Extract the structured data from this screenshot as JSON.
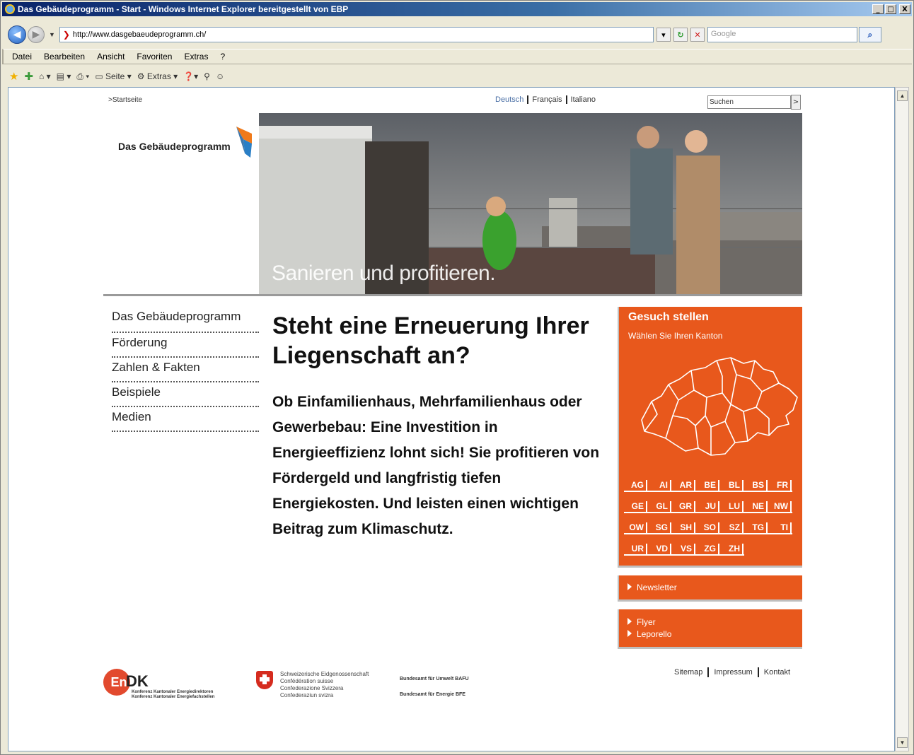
{
  "window": {
    "title": "Das Gebäudeprogramm - Start - Windows Internet Explorer bereitgestellt von EBP",
    "buttons": {
      "minimize": "_",
      "maximize": "□",
      "close": "X"
    }
  },
  "address_bar": {
    "url": "http://www.dasgebaeudeprogramm.ch/",
    "search_placeholder": "Google"
  },
  "menu": [
    "Datei",
    "Bearbeiten",
    "Ansicht",
    "Favoriten",
    "Extras",
    "?"
  ],
  "command_bar": {
    "page_label": "Seite",
    "tools_label": "Extras"
  },
  "page": {
    "breadcrumb": ">Startseite",
    "languages": [
      "Deutsch",
      "Français",
      "Italiano"
    ],
    "search_value": "Suchen",
    "search_button": ">",
    "logo_text": "Das Gebäudeprogramm",
    "hero_caption": "Sanieren und profitieren.",
    "nav": [
      "Das Gebäudeprogramm",
      "Förderung",
      "Zahlen & Fakten",
      "Beispiele",
      "Medien"
    ],
    "headline": "Steht eine Erneuerung Ihrer Liegenschaft an?",
    "lead": "Ob Einfamilienhaus, Mehrfamilienhaus oder Gewerbebau: Eine Investition in Energieeffizienz lohnt sich! Sie profitieren von Fördergeld und langfristig tiefen Energiekosten. Und leisten einen wichtigen Beitrag zum Klimaschutz.",
    "application_box": {
      "title": "Gesuch stellen",
      "subtitle": "Wählen Sie Ihren Kanton",
      "cantons": [
        [
          "AG",
          "AI",
          "AR",
          "BE",
          "BL",
          "BS",
          "FR"
        ],
        [
          "GE",
          "GL",
          "GR",
          "JU",
          "LU",
          "NE",
          "NW"
        ],
        [
          "OW",
          "SG",
          "SH",
          "SO",
          "SZ",
          "TG",
          "TI"
        ],
        [
          "UR",
          "VD",
          "VS",
          "ZG",
          "ZH"
        ]
      ]
    },
    "newsletter": "Newsletter",
    "downloads": [
      "Flyer",
      "Leporello"
    ],
    "footer_links": [
      "Sitemap",
      "Impressum",
      "Kontakt"
    ],
    "endk": {
      "mark": "En",
      "mark2": "DK",
      "line1": "Konferenz Kantonaler Energiedirektoren",
      "line2": "Konferenz Kantonaler Energiefachstellen"
    },
    "confederation": {
      "lines": [
        "Schweizerische Eidgenossenschaft",
        "Confédération suisse",
        "Confederazione Svizzera",
        "Confederaziun svizra"
      ],
      "offices": [
        "Bundesamt für Umwelt BAFU",
        "Bundesamt für Energie BFE"
      ]
    }
  },
  "colors": {
    "accent_orange": "#e8581c",
    "link_blue": "#4a6fa5"
  }
}
